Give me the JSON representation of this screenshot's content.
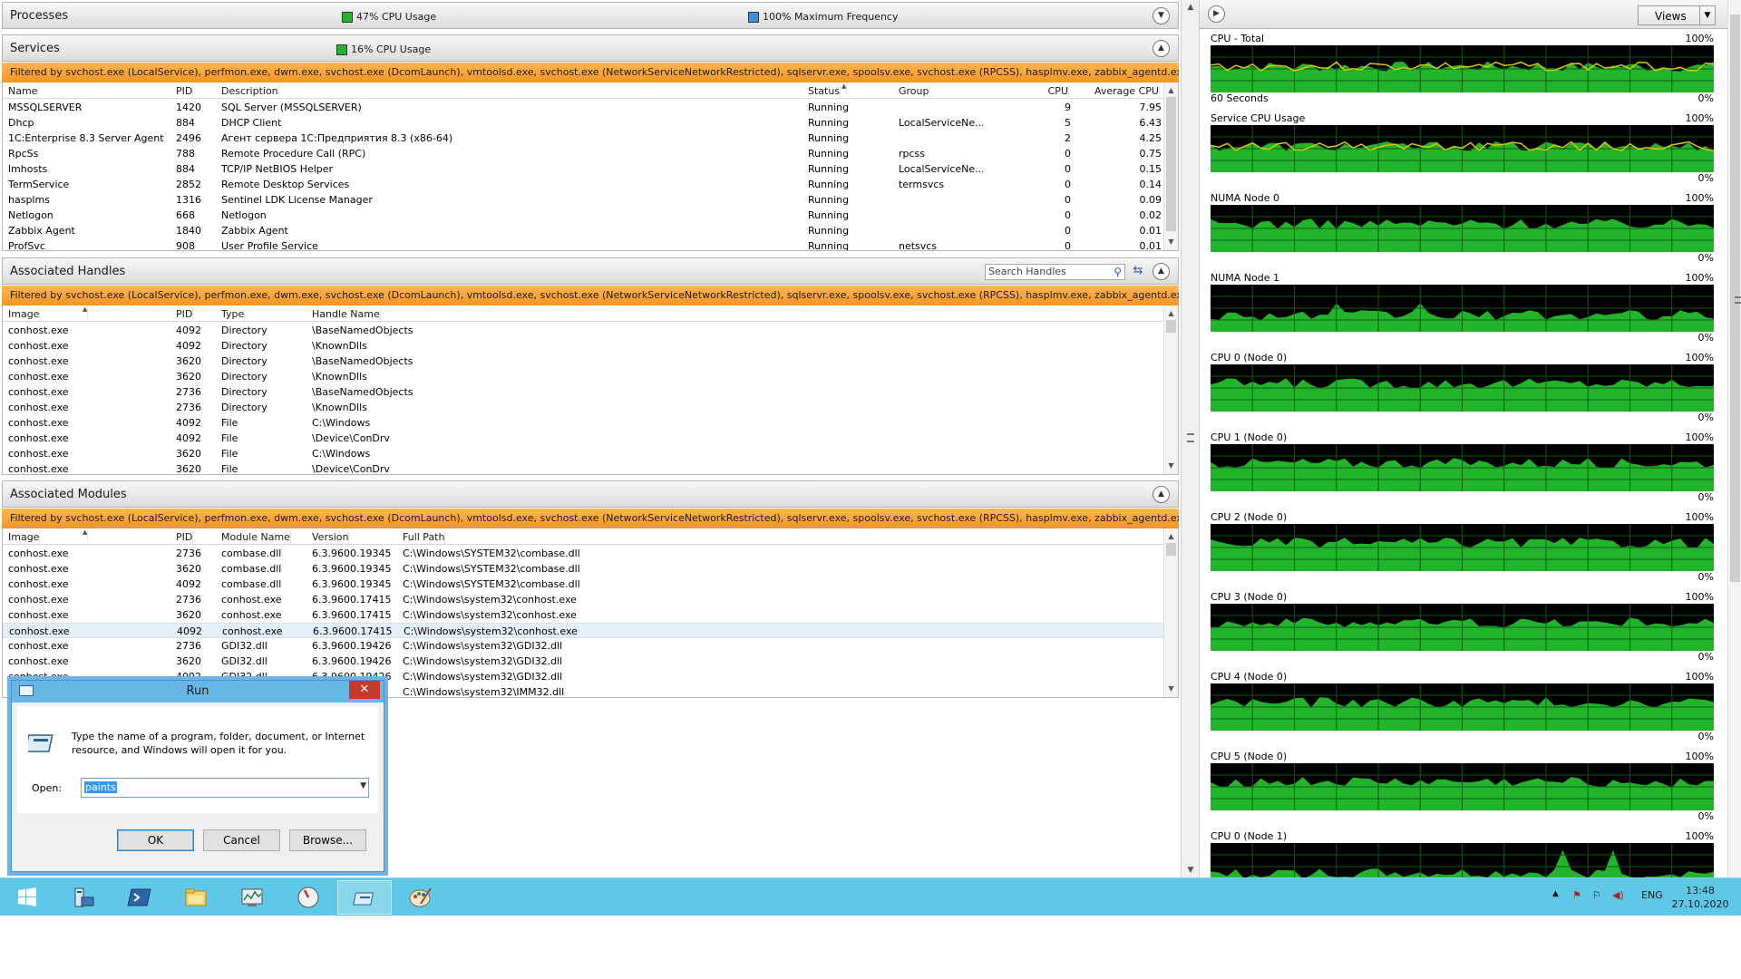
{
  "processes": {
    "title": "Processes",
    "cpu_usage": "47% CPU Usage",
    "max_frequency": "100% Maximum Frequency"
  },
  "services": {
    "title": "Services",
    "cpu_usage": "16% CPU Usage",
    "filter": "Filtered by svchost.exe (LocalService), perfmon.exe, dwm.exe, svchost.exe (DcomLaunch), vmtoolsd.exe, svchost.exe (NetworkServiceNetworkRestricted), sqlservr.exe, spoolsv.exe, svchost.exe (RPCSS), hasplmv.exe, zabbix_agentd.exe, hasplms.e...",
    "columns": [
      "Name",
      "PID",
      "Description",
      "Status",
      "Group",
      "CPU",
      "Average CPU"
    ],
    "rows": [
      [
        "MSSQLSERVER",
        "1420",
        "SQL Server (MSSQLSERVER)",
        "Running",
        "",
        "9",
        "7.95"
      ],
      [
        "Dhcp",
        "884",
        "DHCP Client",
        "Running",
        "LocalServiceNe...",
        "5",
        "6.43"
      ],
      [
        "1C:Enterprise 8.3 Server Agent (...",
        "2496",
        "Агент сервера 1С:Предприятия 8.3 (x86-64)",
        "Running",
        "",
        "2",
        "4.25"
      ],
      [
        "RpcSs",
        "788",
        "Remote Procedure Call (RPC)",
        "Running",
        "rpcss",
        "0",
        "0.75"
      ],
      [
        "lmhosts",
        "884",
        "TCP/IP NetBIOS Helper",
        "Running",
        "LocalServiceNe...",
        "0",
        "0.15"
      ],
      [
        "TermService",
        "2852",
        "Remote Desktop Services",
        "Running",
        "termsvcs",
        "0",
        "0.14"
      ],
      [
        "hasplms",
        "1316",
        "Sentinel LDK License Manager",
        "Running",
        "",
        "0",
        "0.09"
      ],
      [
        "Netlogon",
        "668",
        "Netlogon",
        "Running",
        "",
        "0",
        "0.02"
      ],
      [
        "Zabbix Agent",
        "1840",
        "Zabbix Agent",
        "Running",
        "",
        "0",
        "0.01"
      ],
      [
        "ProfSvc",
        "908",
        "User Profile Service",
        "Running",
        "netsvcs",
        "0",
        "0.01"
      ]
    ]
  },
  "handles": {
    "title": "Associated Handles",
    "search_placeholder": "Search Handles",
    "filter": "Filtered by svchost.exe (LocalService), perfmon.exe, dwm.exe, svchost.exe (DcomLaunch), vmtoolsd.exe, svchost.exe (NetworkServiceNetworkRestricted), sqlservr.exe, spoolsv.exe, svchost.exe (RPCSS), hasplmv.exe, zabbix_agentd.exe, hasplms.e...",
    "columns": [
      "Image",
      "PID",
      "Type",
      "Handle Name"
    ],
    "rows": [
      [
        "conhost.exe",
        "4092",
        "Directory",
        "\\BaseNamedObjects"
      ],
      [
        "conhost.exe",
        "4092",
        "Directory",
        "\\KnownDlls"
      ],
      [
        "conhost.exe",
        "3620",
        "Directory",
        "\\BaseNamedObjects"
      ],
      [
        "conhost.exe",
        "3620",
        "Directory",
        "\\KnownDlls"
      ],
      [
        "conhost.exe",
        "2736",
        "Directory",
        "\\BaseNamedObjects"
      ],
      [
        "conhost.exe",
        "2736",
        "Directory",
        "\\KnownDlls"
      ],
      [
        "conhost.exe",
        "4092",
        "File",
        "C:\\Windows"
      ],
      [
        "conhost.exe",
        "4092",
        "File",
        "\\Device\\ConDrv"
      ],
      [
        "conhost.exe",
        "3620",
        "File",
        "C:\\Windows"
      ],
      [
        "conhost.exe",
        "3620",
        "File",
        "\\Device\\ConDrv"
      ]
    ]
  },
  "modules": {
    "title": "Associated Modules",
    "filter": "Filtered by svchost.exe (LocalService), perfmon.exe, dwm.exe, svchost.exe (DcomLaunch), vmtoolsd.exe, svchost.exe (NetworkServiceNetworkRestricted), sqlservr.exe, spoolsv.exe, svchost.exe (RPCSS), hasplmv.exe, zabbix_agentd.exe, hasplms.e...",
    "columns": [
      "Image",
      "PID",
      "Module Name",
      "Version",
      "Full Path"
    ],
    "rows": [
      [
        "conhost.exe",
        "2736",
        "combase.dll",
        "6.3.9600.19345",
        "C:\\Windows\\SYSTEM32\\combase.dll"
      ],
      [
        "conhost.exe",
        "3620",
        "combase.dll",
        "6.3.9600.19345",
        "C:\\Windows\\SYSTEM32\\combase.dll"
      ],
      [
        "conhost.exe",
        "4092",
        "combase.dll",
        "6.3.9600.19345",
        "C:\\Windows\\SYSTEM32\\combase.dll"
      ],
      [
        "conhost.exe",
        "2736",
        "conhost.exe",
        "6.3.9600.17415",
        "C:\\Windows\\system32\\conhost.exe"
      ],
      [
        "conhost.exe",
        "3620",
        "conhost.exe",
        "6.3.9600.17415",
        "C:\\Windows\\system32\\conhost.exe"
      ],
      [
        "conhost.exe",
        "4092",
        "conhost.exe",
        "6.3.9600.17415",
        "C:\\Windows\\system32\\conhost.exe"
      ],
      [
        "conhost.exe",
        "2736",
        "GDI32.dll",
        "6.3.9600.19426",
        "C:\\Windows\\system32\\GDI32.dll"
      ],
      [
        "conhost.exe",
        "3620",
        "GDI32.dll",
        "6.3.9600.19426",
        "C:\\Windows\\system32\\GDI32.dll"
      ],
      [
        "conhost.exe",
        "4092",
        "GDI32.dll",
        "6.3.9600.19426",
        "C:\\Windows\\system32\\GDI32.dll"
      ],
      [
        "",
        "",
        "",
        "",
        "C:\\Windows\\system32\\IMM32.dll"
      ]
    ]
  },
  "right_pane": {
    "views_label": "Views",
    "graphs": [
      {
        "title": "CPU - Total",
        "max": "100%",
        "min": "0%",
        "sub": "60 Seconds",
        "yellow": true
      },
      {
        "title": "Service CPU Usage",
        "max": "100%",
        "min": "0%",
        "sub": "",
        "yellow": true
      },
      {
        "title": "NUMA Node 0",
        "max": "100%",
        "min": "0%",
        "sub": "",
        "yellow": false
      },
      {
        "title": "NUMA Node 1",
        "max": "100%",
        "min": "0%",
        "sub": "",
        "yellow": false
      },
      {
        "title": "CPU 0 (Node 0)",
        "max": "100%",
        "min": "0%",
        "sub": "",
        "yellow": false
      },
      {
        "title": "CPU 1 (Node 0)",
        "max": "100%",
        "min": "0%",
        "sub": "",
        "yellow": false
      },
      {
        "title": "CPU 2 (Node 0)",
        "max": "100%",
        "min": "0%",
        "sub": "",
        "yellow": false
      },
      {
        "title": "CPU 3 (Node 0)",
        "max": "100%",
        "min": "0%",
        "sub": "",
        "yellow": false
      },
      {
        "title": "CPU 4 (Node 0)",
        "max": "100%",
        "min": "0%",
        "sub": "",
        "yellow": false
      },
      {
        "title": "CPU 5 (Node 0)",
        "max": "100%",
        "min": "0%",
        "sub": "",
        "yellow": false
      },
      {
        "title": "CPU 0 (Node 1)",
        "max": "100%",
        "min": "",
        "sub": "",
        "yellow": false
      }
    ]
  },
  "run_dialog": {
    "title": "Run",
    "close_label": "✕",
    "message": "Type the name of a program, folder, document, or Internet resource, and Windows will open it for you.",
    "open_label": "Open:",
    "open_value": "paints",
    "ok_label": "OK",
    "cancel_label": "Cancel",
    "browse_label": "Browse..."
  },
  "taskbar": {
    "language": "ENG",
    "time": "13:48",
    "date": "27.10.2020",
    "apps": [
      "start",
      "server-manager",
      "powershell",
      "file-explorer",
      "resource-monitor",
      "performance-monitor",
      "run",
      "paint"
    ]
  },
  "colors": {
    "filter_bar": "#f39426",
    "graph_bg": "#000000",
    "graph_fill": "#22b52c",
    "graph_line": "#d8c800",
    "taskbar": "#5fc8e6"
  }
}
